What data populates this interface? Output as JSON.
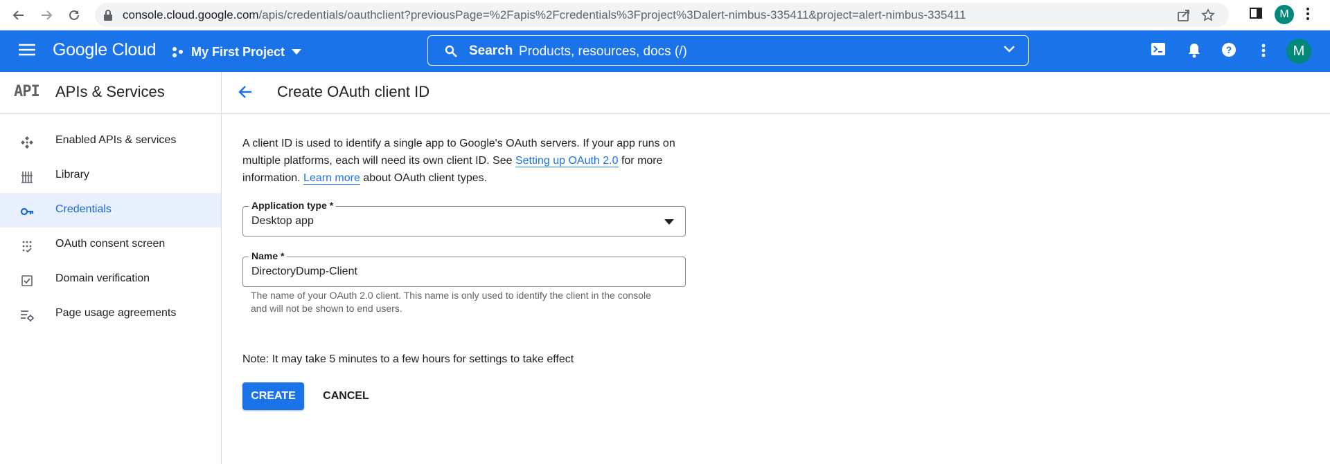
{
  "browser": {
    "url_host": "console.cloud.google.com",
    "url_path": "/apis/credentials/oauthclient?previousPage=%2Fapis%2Fcredentials%3Fproject%3Dalert-nimbus-335411&project=alert-nimbus-335411",
    "profile_initial": "M"
  },
  "header": {
    "logo": "Google Cloud",
    "project": "My First Project",
    "search_label": "Search",
    "search_hint": "Products, resources, docs (/)",
    "avatar_initial": "M"
  },
  "sidebar": {
    "api_badge": "API",
    "title": "APIs & Services",
    "items": [
      {
        "label": "Enabled APIs & services",
        "icon": "apis-icon",
        "active": false
      },
      {
        "label": "Library",
        "icon": "library-icon",
        "active": false
      },
      {
        "label": "Credentials",
        "icon": "key-icon",
        "active": true
      },
      {
        "label": "OAuth consent screen",
        "icon": "consent-icon",
        "active": false
      },
      {
        "label": "Domain verification",
        "icon": "checkbox-icon",
        "active": false
      },
      {
        "label": "Page usage agreements",
        "icon": "settings-list-icon",
        "active": false
      }
    ]
  },
  "main": {
    "title": "Create OAuth client ID",
    "intro_1": "A client ID is used to identify a single app to Google's OAuth servers. If your app runs on multiple platforms, each will need its own client ID. See ",
    "intro_link_1": "Setting up OAuth 2.0",
    "intro_2": " for more information. ",
    "intro_link_2": "Learn more",
    "intro_3": " about OAuth client types.",
    "app_type_label": "Application type *",
    "app_type_value": "Desktop app",
    "name_label": "Name *",
    "name_value": "DirectoryDump-Client",
    "name_helper": "The name of your OAuth 2.0 client. This name is only used to identify the client in the console and will not be shown to end users.",
    "note": "Note: It may take 5 minutes to a few hours for settings to take effect",
    "create_label": "CREATE",
    "cancel_label": "CANCEL"
  },
  "colors": {
    "brand_blue": "#1a73e8",
    "active_bg": "#e8f0fe",
    "avatar_teal": "#00897b"
  }
}
